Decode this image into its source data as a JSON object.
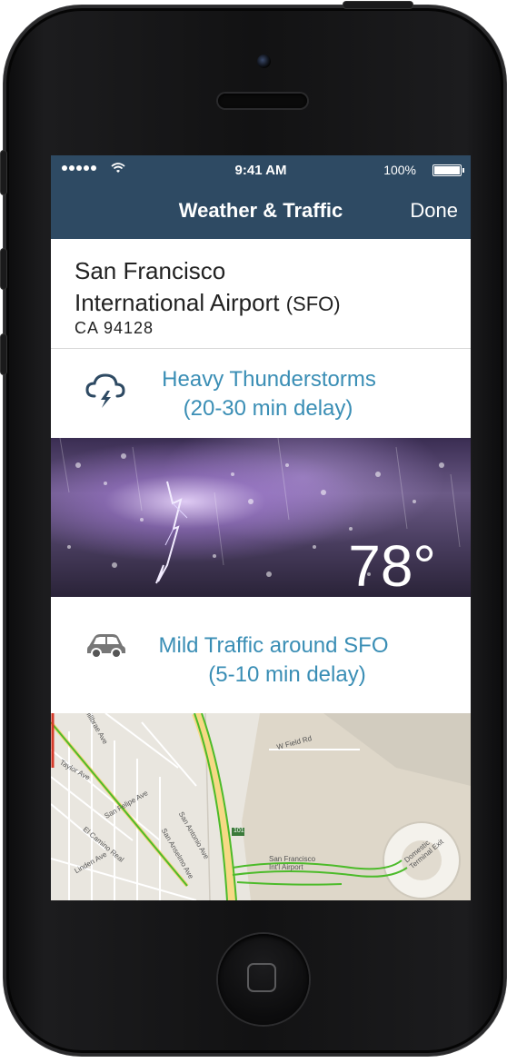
{
  "status_bar": {
    "time": "9:41 AM",
    "battery": "100%"
  },
  "nav": {
    "title": "Weather & Traffic",
    "done_label": "Done"
  },
  "airport": {
    "name_line1": "San Francisco",
    "name_line2": "International Airport",
    "code": "(SFO)",
    "location": "CA  94128"
  },
  "weather": {
    "condition": "Heavy Thunderstorms",
    "delay": "(20-30 min delay)",
    "temperature": "78°",
    "icon": "thunderstorm-cloud-icon"
  },
  "traffic": {
    "condition": "Mild Traffic around SFO",
    "delay": "(5-10 min delay)",
    "icon": "car-icon"
  },
  "map": {
    "labels": [
      "Millbrae Ave",
      "Taylor Ave",
      "San Felipe Ave",
      "El Camino Real",
      "Linden Ave",
      "San Anselmo Ave",
      "San Antonio Ave",
      "W Field Rd",
      "101",
      "San Francisco Int'l Airport",
      "Domestic Terminal Exit"
    ]
  },
  "colors": {
    "navbar": "#2e4a63",
    "accent": "#3a8eb5",
    "traffic_green": "#4cbb2a"
  }
}
